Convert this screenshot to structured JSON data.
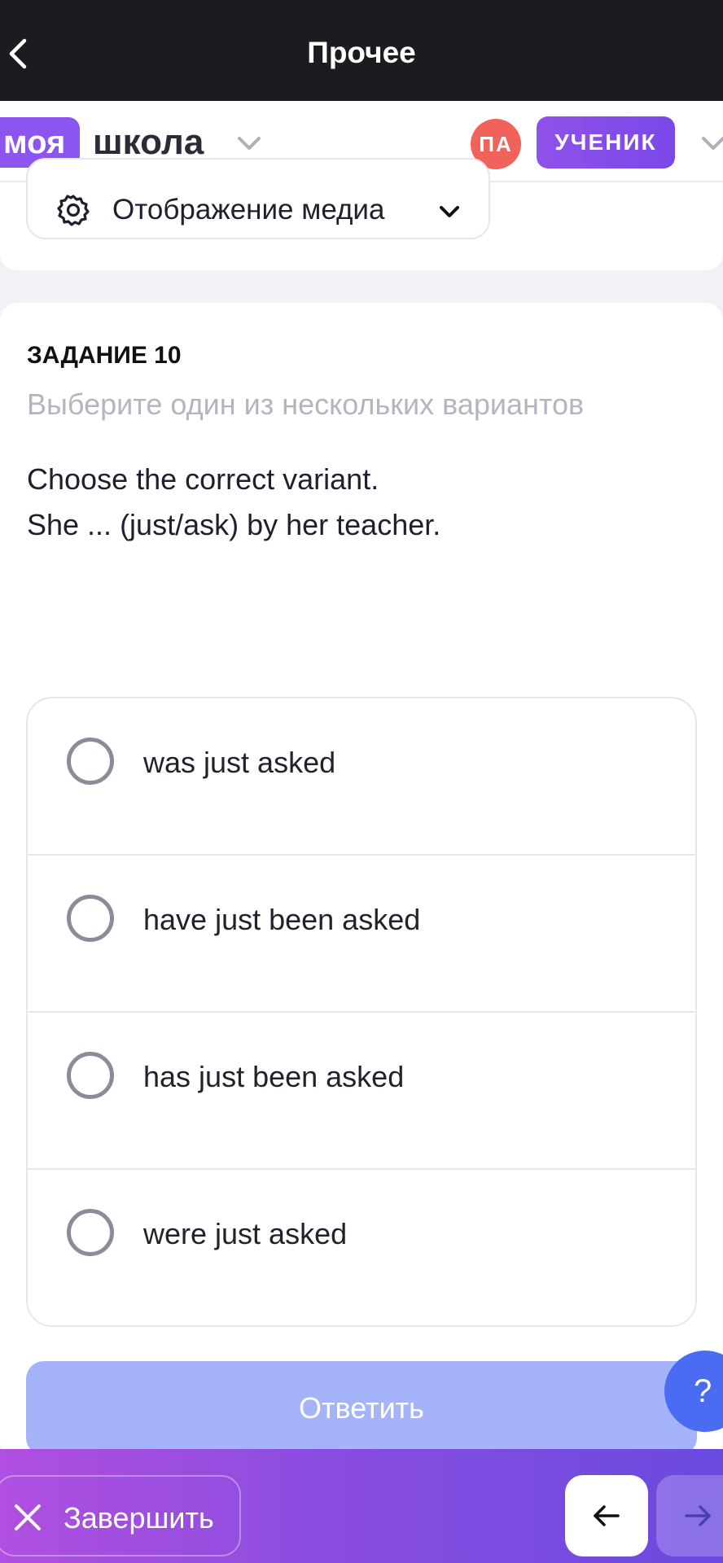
{
  "topbar": {
    "title": "Прочее",
    "back_icon": "chevron-left-icon"
  },
  "header": {
    "logo_part1": "моя",
    "logo_part2": "школа",
    "avatar_initials": "ПА",
    "role": "УЧЕНИК",
    "colors": {
      "brand": "#8d55f0",
      "avatar": "#f0625a"
    }
  },
  "media": {
    "label": "Отображение медиа",
    "icon": "gear-icon"
  },
  "task": {
    "title": "ЗАДАНИЕ 10",
    "subtitle": "Выберите один из нескольких вариантов",
    "question_line1": "Choose the correct variant.",
    "question_line2": "She ... (just/ask) by her teacher.",
    "options": [
      {
        "label": "was just asked",
        "selected": false
      },
      {
        "label": "have just been asked",
        "selected": false
      },
      {
        "label": "has just been asked",
        "selected": false
      },
      {
        "label": "were just asked",
        "selected": false
      }
    ],
    "answer_button": "Ответить"
  },
  "help": {
    "label": "?"
  },
  "bottombar": {
    "finish_label": "Завершить",
    "prev_icon": "arrow-left-icon",
    "next_icon": "arrow-right-icon"
  }
}
